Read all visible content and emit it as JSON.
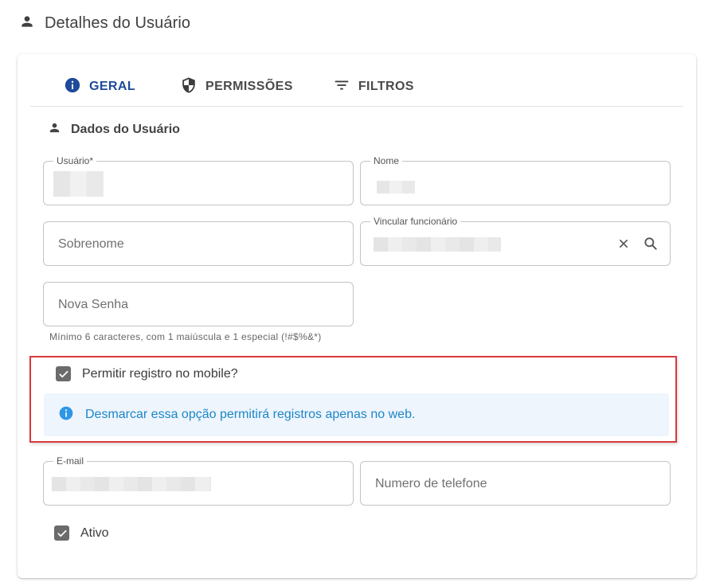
{
  "header": {
    "title": "Detalhes do Usuário",
    "icon": "person-icon"
  },
  "tabs": [
    {
      "label": "GERAL",
      "icon": "info-icon",
      "active": true
    },
    {
      "label": "PERMISSÕES",
      "icon": "shield-icon",
      "active": false
    },
    {
      "label": "FILTROS",
      "icon": "filter-icon",
      "active": false
    }
  ],
  "section": {
    "title": "Dados do Usuário",
    "icon": "person-icon"
  },
  "form": {
    "usuario": {
      "label": "Usuário*",
      "value": ""
    },
    "nome": {
      "label": "Nome",
      "value": ""
    },
    "sobrenome": {
      "placeholder": "Sobrenome"
    },
    "vincular": {
      "label": "Vincular funcionário",
      "value": ""
    },
    "nova_senha": {
      "placeholder": "Nova Senha",
      "helper": "Mínimo 6 caracteres, com 1 maiúscula e 1 especial (!#$%&*)"
    },
    "mobile": {
      "label": "Permitir registro no mobile?",
      "checked": true
    },
    "info": {
      "text": "Desmarcar essa opção permitirá registros apenas no web."
    },
    "email": {
      "label": "E-mail",
      "value": ""
    },
    "telefone": {
      "placeholder": "Numero de telefone"
    },
    "ativo": {
      "label": "Ativo",
      "checked": true
    }
  },
  "colors": {
    "accent": "#1e4a9a",
    "info_text": "#1d86c8",
    "info_bg": "#eef5fd",
    "highlight_border": "#d9393d",
    "checkbox": "#6b6b6b"
  }
}
